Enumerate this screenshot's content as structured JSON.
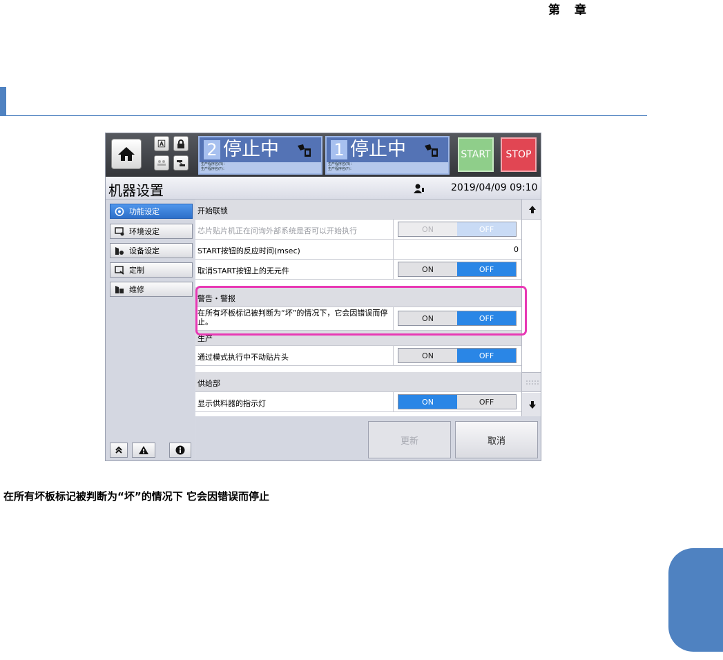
{
  "document": {
    "chapter_label": [
      "第",
      "章"
    ],
    "caption": "在所有坏板标记被判断为“坏”的情况下  它会因错误而停止"
  },
  "screen": {
    "status_panels": [
      {
        "number": "2",
        "state": "停止中",
        "line1": "生产程序名(R)：",
        "line2": "生产程序名(F)："
      },
      {
        "number": "1",
        "state": "停止中",
        "line1": "生产程序名(R)：",
        "line2": "生产程序名(F)："
      }
    ],
    "start_label": "START",
    "stop_label": "STOP",
    "title": "机器设置",
    "datetime": "2019/04/09 09:10",
    "menu": [
      {
        "label": "功能设定",
        "icon": "gear-cycle-icon",
        "selected": true
      },
      {
        "label": "环境设定",
        "icon": "monitor-settings-icon",
        "selected": false
      },
      {
        "label": "设备设定",
        "icon": "device-settings-icon",
        "selected": false
      },
      {
        "label": "定制",
        "icon": "custom-icon",
        "selected": false
      },
      {
        "label": "维修",
        "icon": "maintenance-icon",
        "selected": false
      }
    ],
    "rows": [
      {
        "type": "header",
        "label": "开始联锁"
      },
      {
        "type": "toggle",
        "label": "芯片贴片机正在问询外部系统是否可以开始执行",
        "on": "ON",
        "off": "OFF",
        "value": "OFF",
        "disabled": true
      },
      {
        "type": "number",
        "label": "START按钮的反应时间(msec)",
        "value": "0"
      },
      {
        "type": "toggle",
        "label": "取消START按钮上的无元件",
        "on": "ON",
        "off": "OFF",
        "value": "OFF",
        "disabled": false
      },
      {
        "type": "header",
        "label": "警告・警报"
      },
      {
        "type": "toggle",
        "label": "在所有坏板标记被判断为“坏”的情况下，它会因错误而停止。",
        "on": "ON",
        "off": "OFF",
        "value": "OFF",
        "disabled": false,
        "two_line": true
      },
      {
        "type": "header",
        "label": "生产"
      },
      {
        "type": "toggle",
        "label": "通过模式执行中不动贴片头",
        "on": "ON",
        "off": "OFF",
        "value": "OFF",
        "disabled": false
      },
      {
        "type": "header",
        "label": "供给部"
      },
      {
        "type": "toggle",
        "label": "显示供料器的指示灯",
        "on": "ON",
        "off": "OFF",
        "value": "ON",
        "disabled": false
      }
    ],
    "update_label": "更新",
    "cancel_label": "取消"
  },
  "colors": {
    "accent_blue": "#4f82c1",
    "toggle_active": "#2a86e6",
    "highlight": "#e838b4",
    "start_green": "#8fce8a",
    "stop_red": "#e14653"
  }
}
